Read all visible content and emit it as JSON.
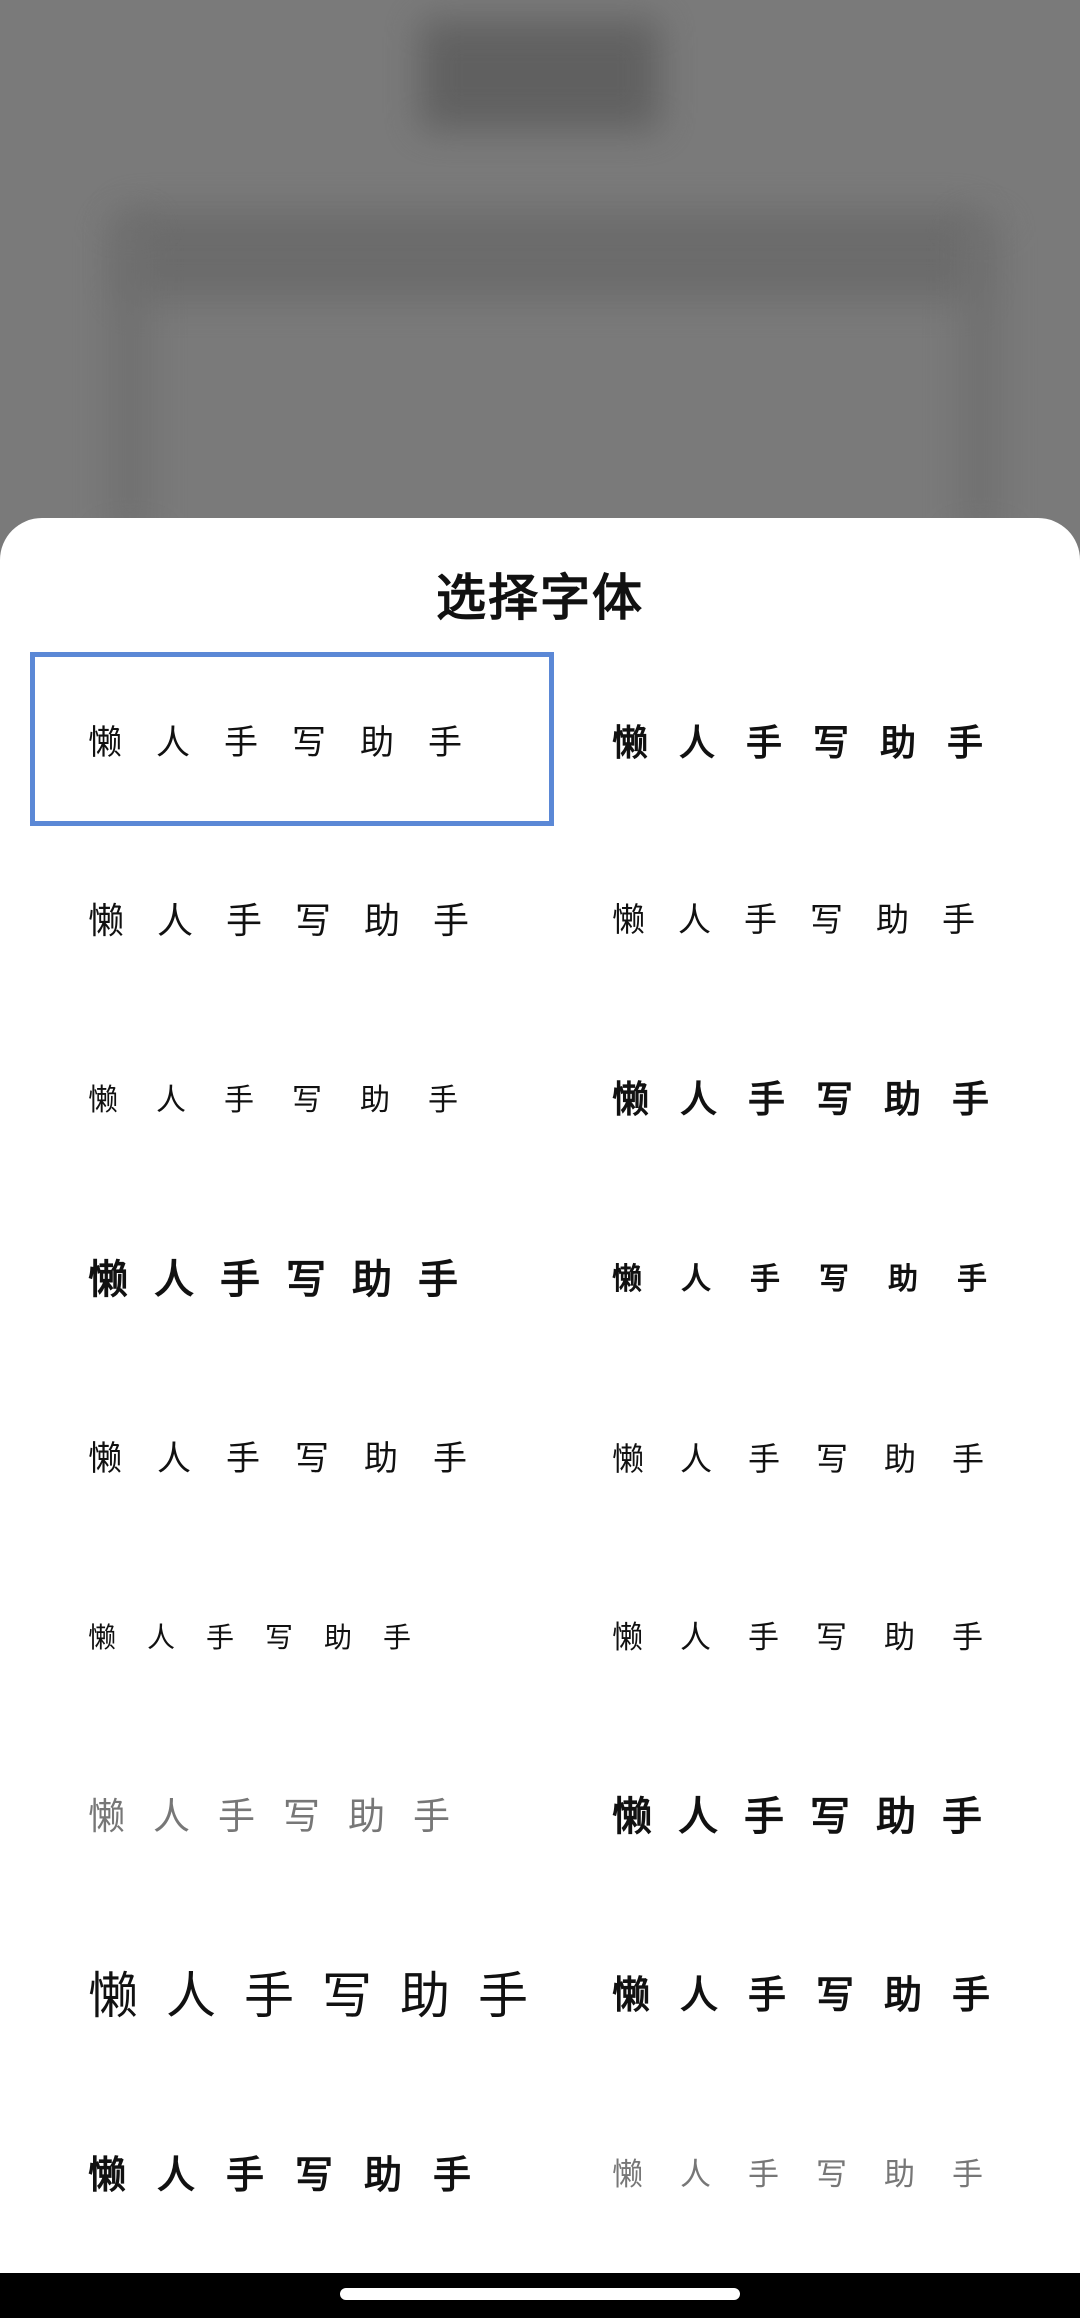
{
  "sheet": {
    "title": "选择字体"
  },
  "fonts": [
    {
      "sample": "懒人手写助手"
    },
    {
      "sample": "懒人手写助手"
    },
    {
      "sample": "懒人手写助手"
    },
    {
      "sample": "懒人手写助手"
    },
    {
      "sample": "懒人手写助手"
    },
    {
      "sample": "懒人手写助手"
    },
    {
      "sample": "懒人手写助手"
    },
    {
      "sample": "懒人手写助手"
    },
    {
      "sample": "懒人手写助手"
    },
    {
      "sample": "懒人手写助手"
    },
    {
      "sample": "懒人手写助手"
    },
    {
      "sample": "懒人手写助手"
    },
    {
      "sample": "懒人手写助手"
    },
    {
      "sample": "懒人手写助手"
    },
    {
      "sample": "懒人手写助手"
    },
    {
      "sample": "懒人手写助手"
    },
    {
      "sample": "懒人手写助手"
    },
    {
      "sample": "懒人手写助手"
    }
  ],
  "colors": {
    "selection_border": "#5b88d6",
    "backdrop": "#777777"
  }
}
